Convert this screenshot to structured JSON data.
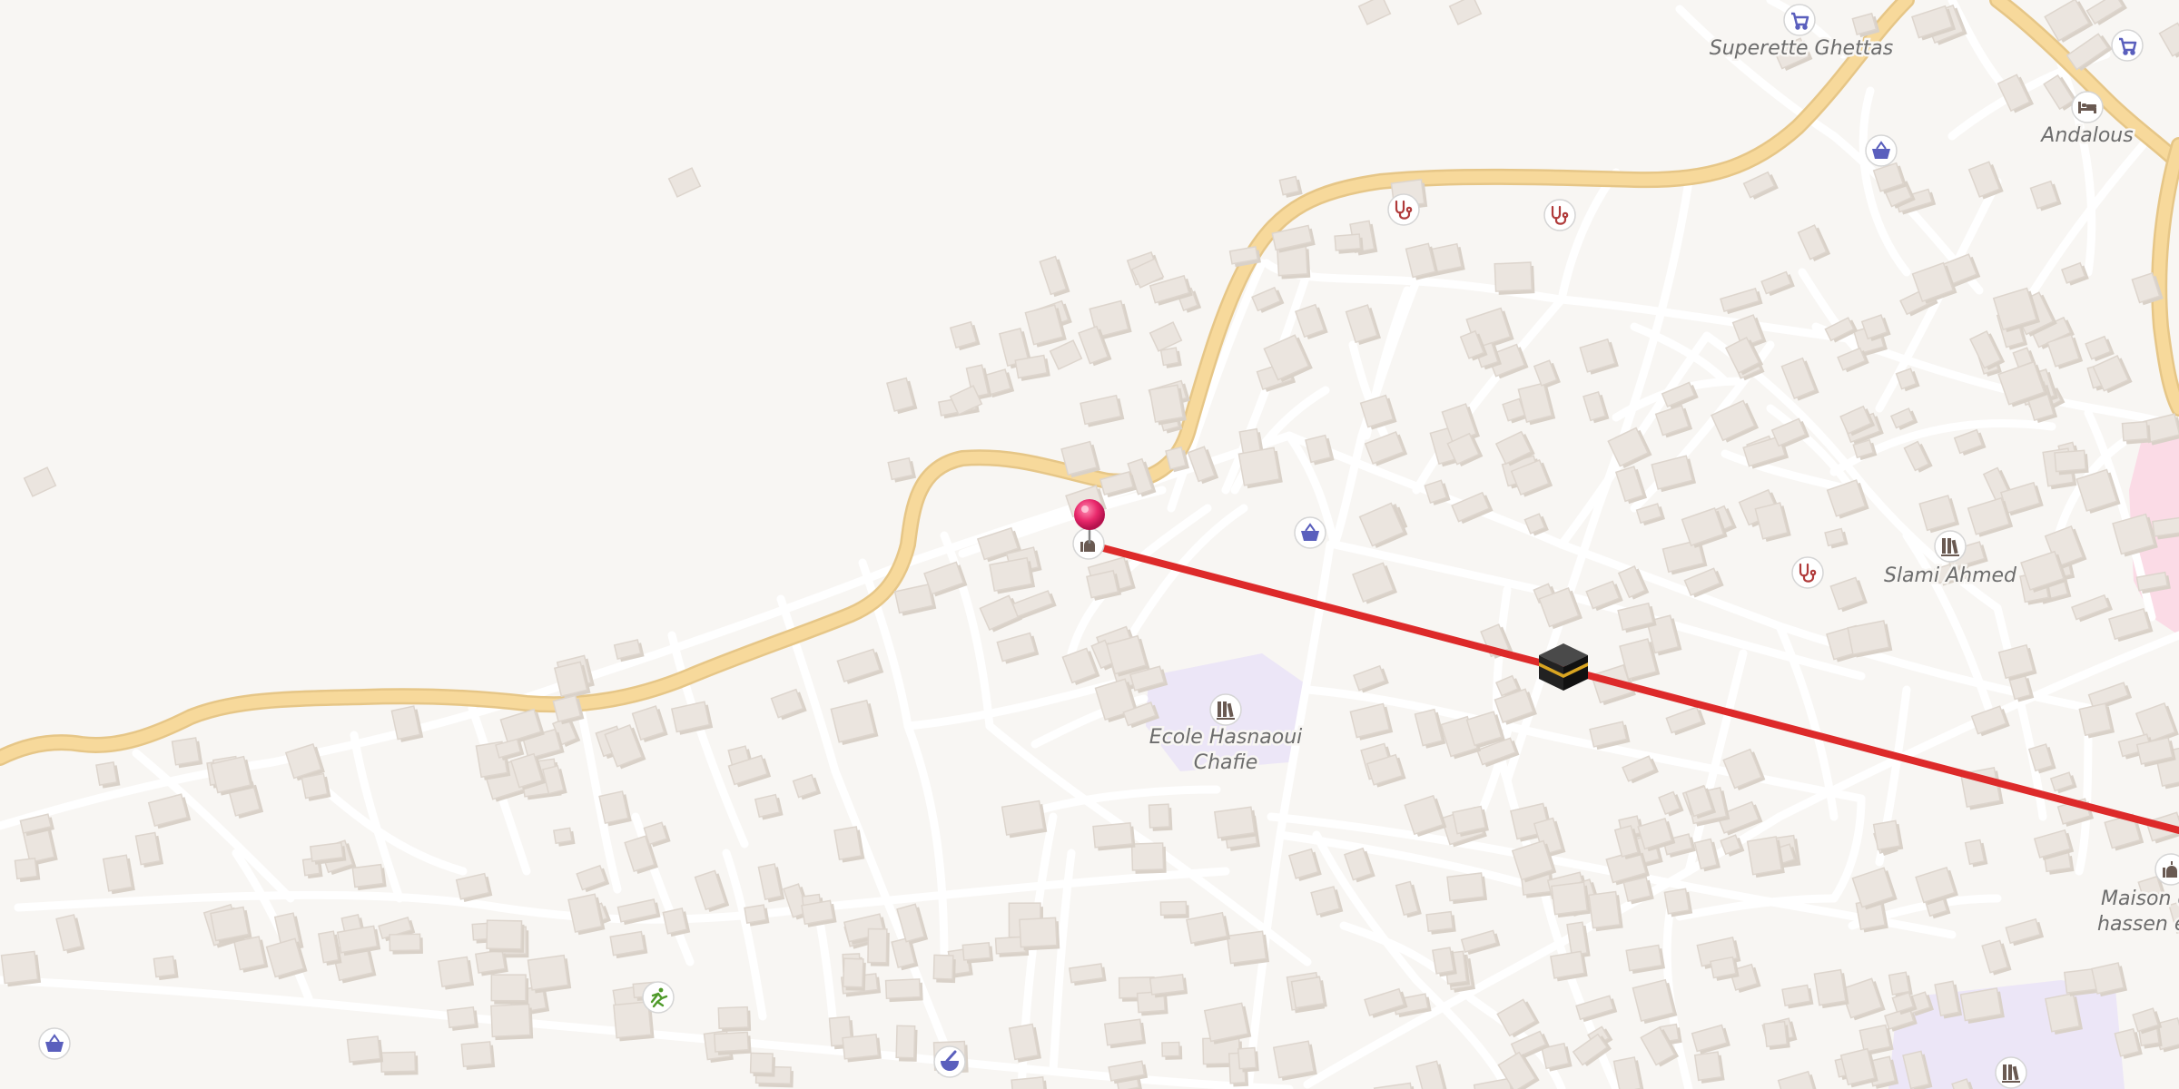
{
  "map": {
    "labels": {
      "superette": "Superette Ghettas",
      "andalous": "Andalous",
      "slami": "Slami Ahmed",
      "ecole_line1": "Ecole Hasnaoui",
      "ecole_line2": "Chafie",
      "maison_line1": "Maison d",
      "maison_line2": "hassen e"
    },
    "icons": [
      "shopping-cart-icon",
      "bed-icon",
      "shopping-basket-icon",
      "stethoscope-icon",
      "library-icon",
      "mosque-icon",
      "kaaba-icon",
      "running-person-icon",
      "pharmacy-mortar-icon",
      "map-pin-icon"
    ],
    "colors": {
      "background": "#f8f6f3",
      "major_road": "#f7d99b",
      "minor_road": "#ffffff",
      "building": "#ebe5df",
      "route_line": "#dd2a2a",
      "pin": "#e8286b",
      "school_area": "#ece6f7",
      "pink_area": "#fbdbe6",
      "shop_icon": "#5a5fbd",
      "health_icon": "#b03a3a"
    }
  }
}
